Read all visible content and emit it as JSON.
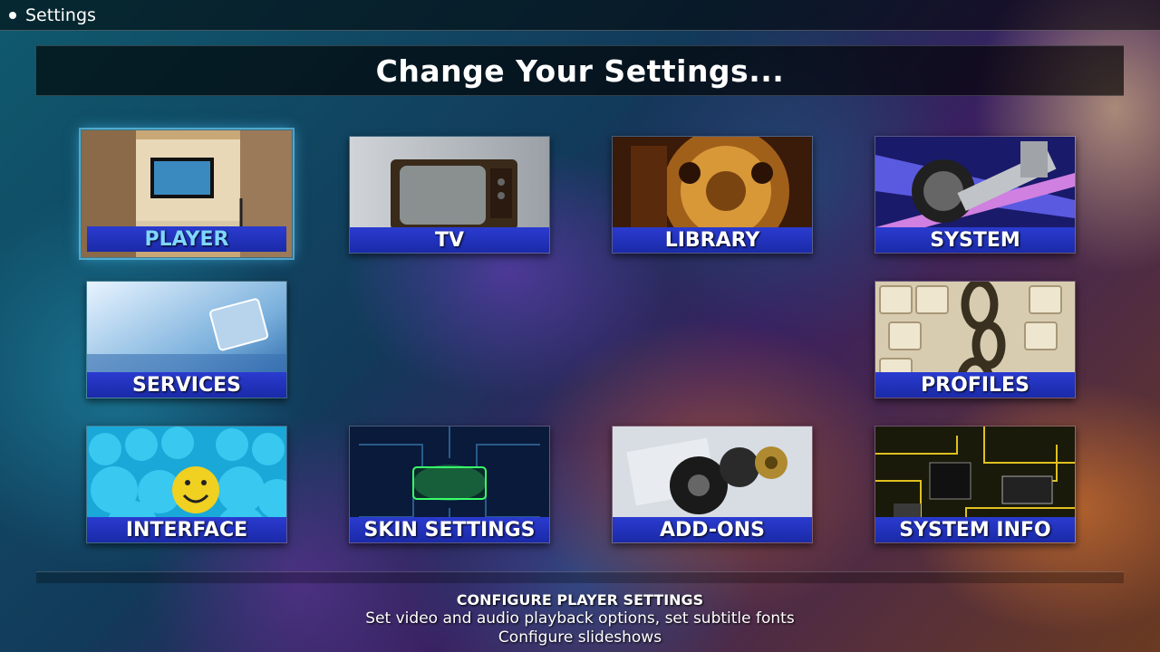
{
  "header": {
    "breadcrumb": "Settings"
  },
  "page_title": "Change Your Settings...",
  "tiles": [
    {
      "label": "PLAYER",
      "icon": "home-theater-tv-icon",
      "selected": true
    },
    {
      "label": "TV",
      "icon": "retro-tv-icon",
      "selected": false
    },
    {
      "label": "LIBRARY",
      "icon": "film-reel-icon",
      "selected": false
    },
    {
      "label": "SYSTEM",
      "icon": "wrench-disc-icon",
      "selected": false
    },
    {
      "label": "SERVICES",
      "icon": "network-plug-icon",
      "selected": false
    },
    {
      "label": "PROFILES",
      "icon": "chain-keyboard-icon",
      "selected": false
    },
    {
      "label": "INTERFACE",
      "icon": "smiley-balls-icon",
      "selected": false
    },
    {
      "label": "SKIN SETTINGS",
      "icon": "circuit-geek-icon",
      "selected": false
    },
    {
      "label": "ADD-ONS",
      "icon": "gears-icon",
      "selected": false
    },
    {
      "label": "SYSTEM INFO",
      "icon": "circuit-board-icon",
      "selected": false
    }
  ],
  "description": {
    "title": "CONFIGURE PLAYER SETTINGS",
    "line1": "Set video and audio playback options, set subtitle fonts",
    "line2": "Configure slideshows"
  },
  "colors": {
    "label_bar": "#2a3bd0",
    "focus_text": "#7fd6ff",
    "title_bar": "#000000"
  }
}
